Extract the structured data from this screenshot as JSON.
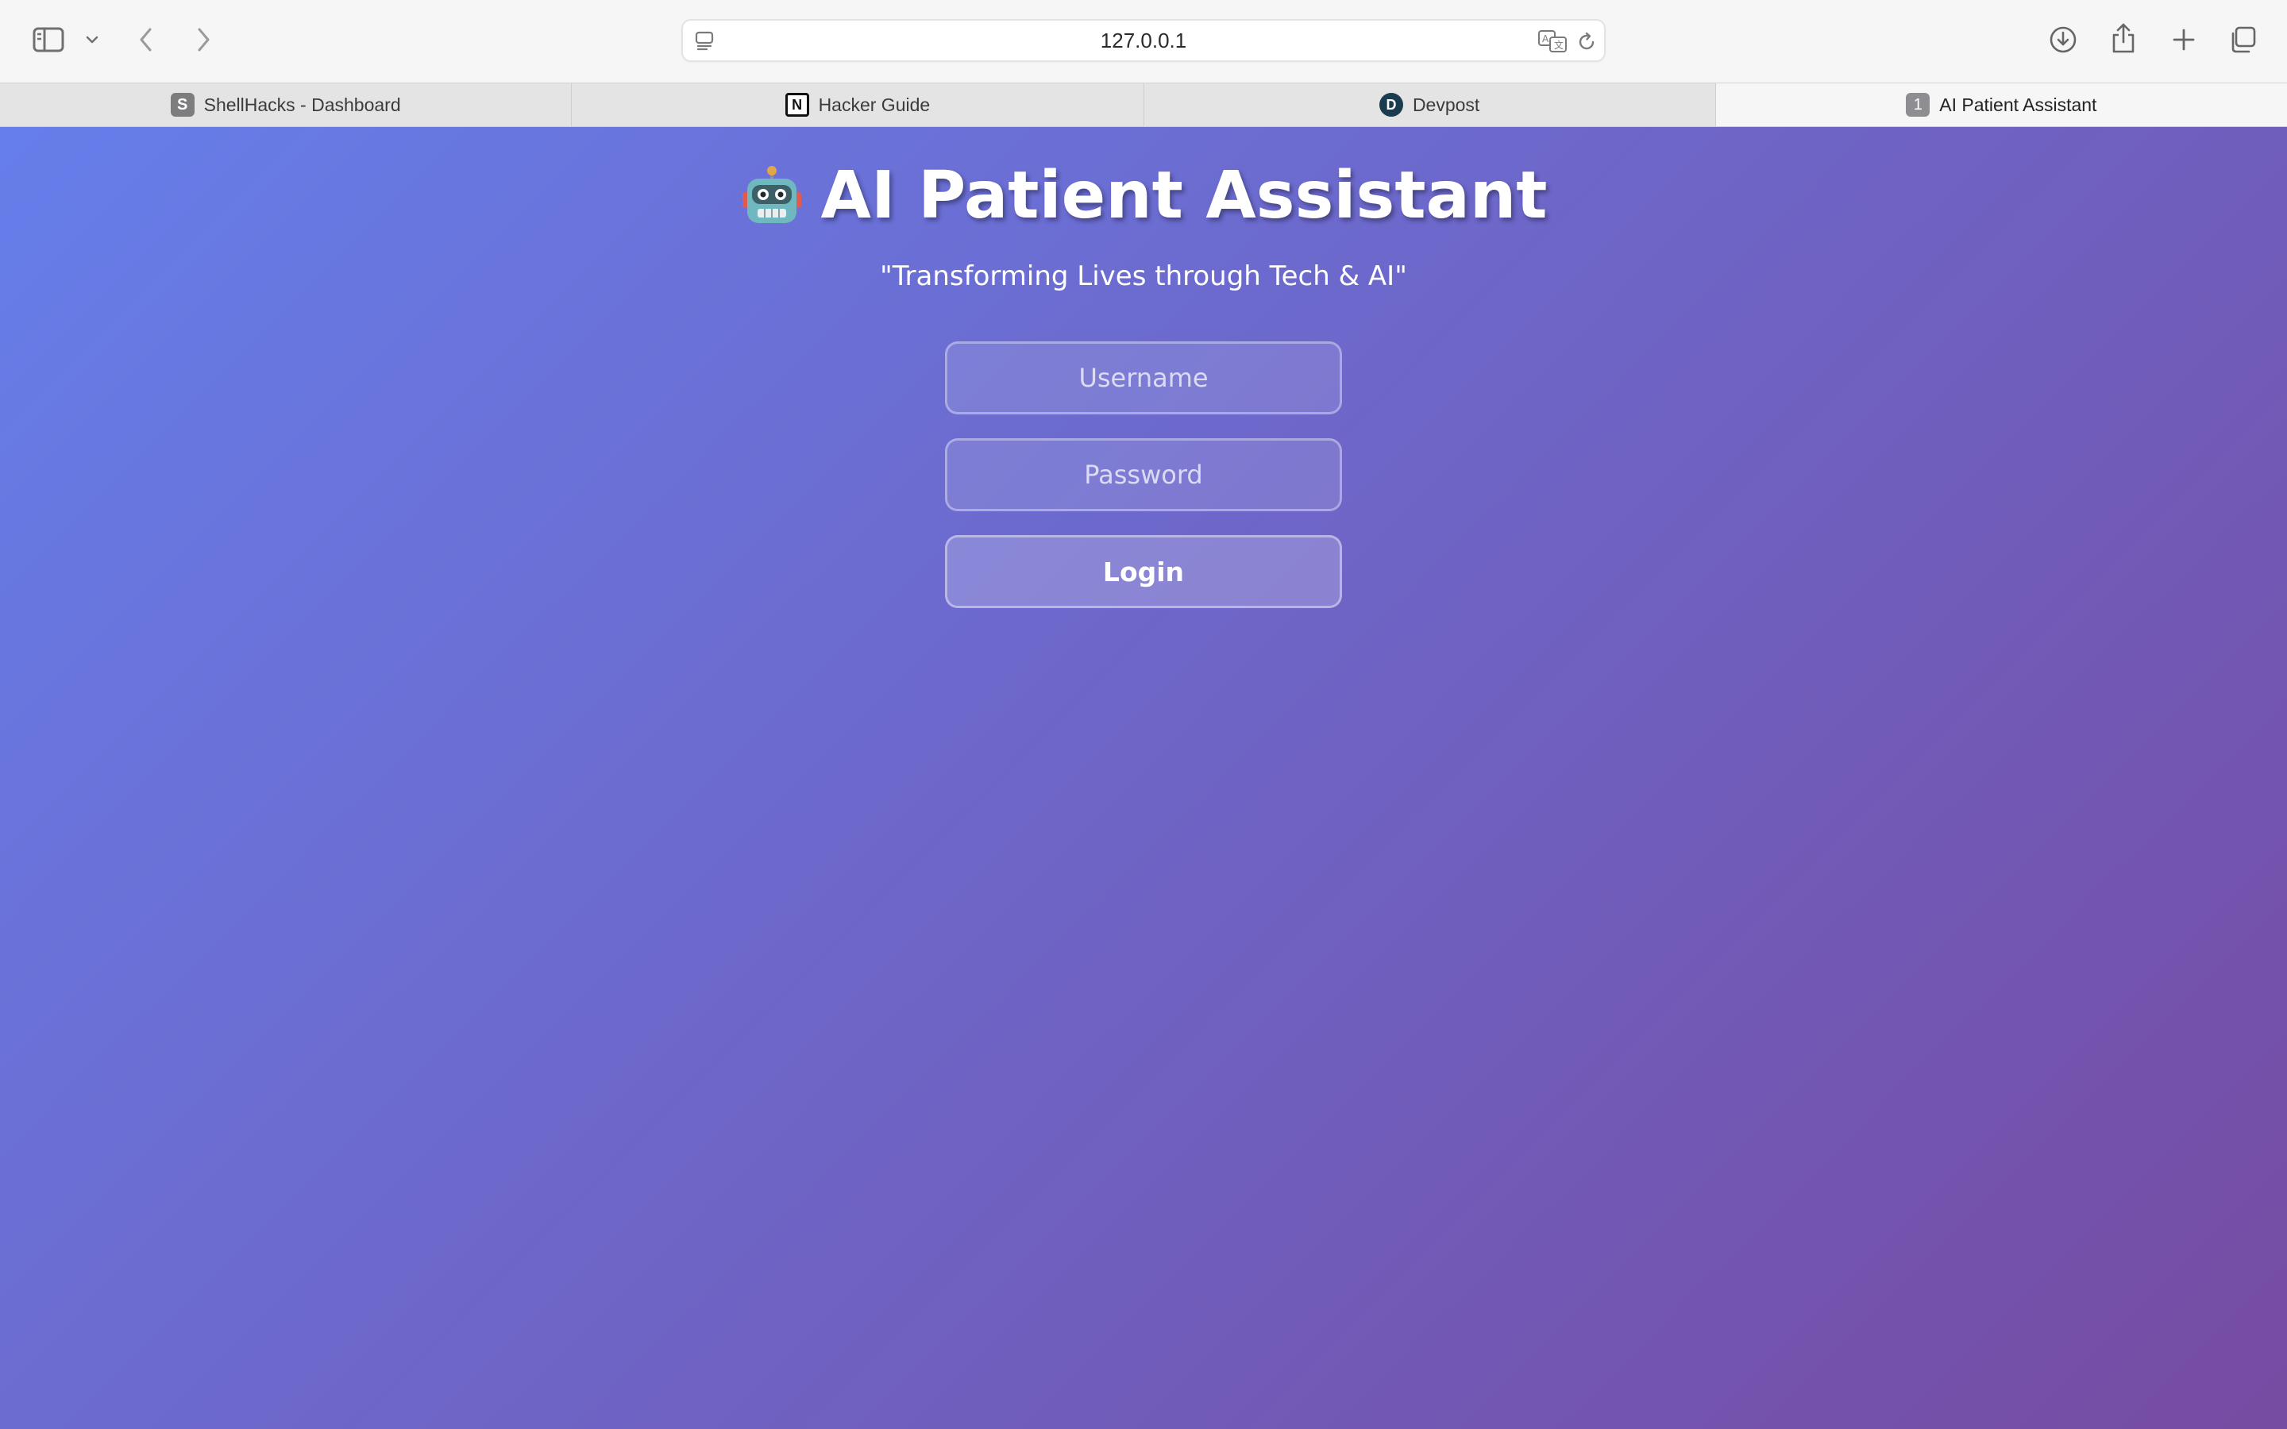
{
  "browser": {
    "address": "127.0.0.1",
    "icons": {
      "sidebar": "sidebar-icon",
      "sidebar_menu": "chevron-down-icon",
      "back": "chevron-left-icon",
      "forward": "chevron-right-icon",
      "page_menu": "page-menu-icon",
      "translate": "translate-icon",
      "reload": "reload-icon",
      "downloads": "download-icon",
      "share": "share-icon",
      "new_tab": "plus-icon",
      "tab_overview": "tab-overview-icon"
    }
  },
  "tabs": [
    {
      "label": "ShellHacks - Dashboard",
      "favicon": "S",
      "active": false
    },
    {
      "label": "Hacker Guide",
      "favicon": "N",
      "active": false
    },
    {
      "label": "Devpost",
      "favicon": "D",
      "active": false
    },
    {
      "label": "AI Patient Assistant",
      "favicon": "1",
      "active": true
    }
  ],
  "app": {
    "title": "AI Patient Assistant",
    "title_icon": "robot-icon",
    "tagline": "\"Transforming Lives through Tech & AI\"",
    "username_placeholder": "Username",
    "password_placeholder": "Password",
    "login_label": "Login",
    "colors": {
      "gradient_start": "#667eea",
      "gradient_end": "#764ba2"
    }
  }
}
